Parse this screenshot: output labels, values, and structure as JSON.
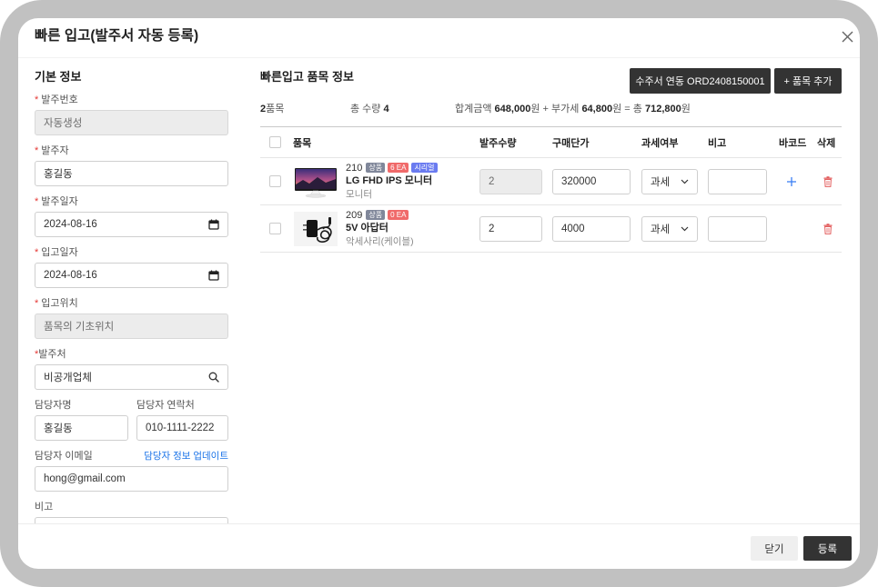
{
  "modal": {
    "title": "빠른 입고(발주서 자동 등록)",
    "close_icon": "close-icon"
  },
  "colors": {
    "dark_button": "#333333",
    "required": "#e53935",
    "link": "#1a73e8",
    "barcode_add": "#3b7ff5",
    "delete": "#e35d5d"
  },
  "basic_info": {
    "heading": "기본 정보",
    "required_mark": "*",
    "order_no": {
      "label": "발주번호",
      "value": "자동생성"
    },
    "orderer": {
      "label": "발주자",
      "value": "홍길동"
    },
    "order_date": {
      "label": "발주일자",
      "value": "2024-08-16",
      "icon": "calendar-icon"
    },
    "receive_date": {
      "label": "입고일자",
      "value": "2024-08-16",
      "icon": "calendar-icon"
    },
    "receive_location": {
      "label": "입고위치",
      "value": "품목의 기초위치"
    },
    "supplier": {
      "label": "발주처",
      "value": "비공개업체",
      "icon": "search-icon"
    },
    "contact_name": {
      "label": "담당자명",
      "value": "홍길동"
    },
    "contact_phone": {
      "label": "담당자 연락처",
      "value": "010-1111-2222"
    },
    "contact_email": {
      "label": "담당자 이메일",
      "value": "hong@gmail.com"
    },
    "contact_update_link": "담당자 정보 업데이트",
    "memo": {
      "label": "비고",
      "value": ""
    }
  },
  "items_panel": {
    "heading": "빠른입고 품목 정보",
    "link_order_button": "수주서 연동 ORD2408150001",
    "add_item_button": "+ 품목 추가",
    "summary": {
      "item_count": "2",
      "item_count_unit": "품목",
      "total_qty_label": "총 수량",
      "total_qty": "4",
      "amount_label": "합계금액",
      "amount": "648,000",
      "currency": "원",
      "plus": "+",
      "vat_label": "부가세",
      "vat": "64,800",
      "equals": "=",
      "total_label": "총",
      "total": "712,800"
    },
    "columns": {
      "product": "품목",
      "order_qty": "발주수량",
      "unit_price": "구매단가",
      "tax_type": "과세여부",
      "memo": "비고",
      "barcode": "바코드",
      "delete": "삭제"
    },
    "rows": [
      {
        "code": "210",
        "badges": [
          {
            "text": "상품",
            "color": "#80879a"
          },
          {
            "text": "6 EA",
            "color": "#f06a6a"
          },
          {
            "text": "시리얼",
            "color": "#6a7bf0"
          }
        ],
        "name": "LG FHD IPS 모니터",
        "category": "모니터",
        "order_qty": "2",
        "order_qty_editable": false,
        "unit_price": "320000",
        "tax_type": "과세",
        "memo": "",
        "barcode_icon": "plus-icon",
        "delete_icon": "trash-icon"
      },
      {
        "code": "209",
        "badges": [
          {
            "text": "상품",
            "color": "#80879a"
          },
          {
            "text": "0 EA",
            "color": "#f06a6a"
          }
        ],
        "name": "5V 아답터",
        "category": "악세사리(케이블)",
        "order_qty": "2",
        "order_qty_editable": true,
        "unit_price": "4000",
        "tax_type": "과세",
        "memo": "",
        "delete_icon": "trash-icon"
      }
    ]
  },
  "footer": {
    "close_button": "닫기",
    "submit_button": "등록"
  }
}
